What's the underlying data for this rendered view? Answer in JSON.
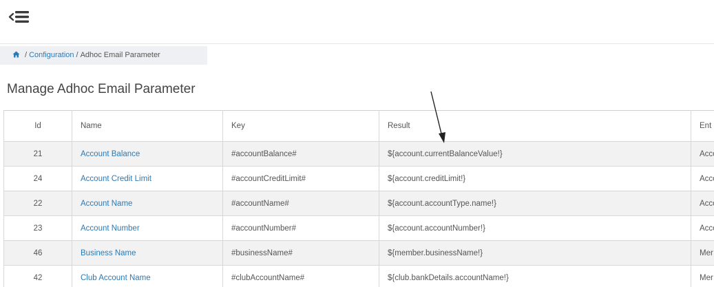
{
  "header": {
    "menu_toggle_icon": "menu-collapse-icon"
  },
  "breadcrumb": {
    "home_icon": "home-icon",
    "sep1": "/",
    "configuration": "Configuration",
    "sep2": "/",
    "current": "Adhoc Email Parameter"
  },
  "page": {
    "title": "Manage Adhoc Email Parameter"
  },
  "table": {
    "columns": {
      "id": "Id",
      "name": "Name",
      "key": "Key",
      "result": "Result",
      "entity": "Ent"
    },
    "rows": [
      {
        "id": "21",
        "name": "Account Balance",
        "key": "#accountBalance#",
        "result": "${account.currentBalanceValue!}",
        "entity": "Acco"
      },
      {
        "id": "24",
        "name": "Account Credit Limit",
        "key": "#accountCreditLimit#",
        "result": "${account.creditLimit!}",
        "entity": "Acco"
      },
      {
        "id": "22",
        "name": "Account Name",
        "key": "#accountName#",
        "result": "${account.accountType.name!}",
        "entity": "Acco"
      },
      {
        "id": "23",
        "name": "Account Number",
        "key": "#accountNumber#",
        "result": "${account.accountNumber!}",
        "entity": "Acco"
      },
      {
        "id": "46",
        "name": "Business Name",
        "key": "#businessName#",
        "result": "${member.businessName!}",
        "entity": "Mer"
      },
      {
        "id": "42",
        "name": "Club Account Name",
        "key": "#clubAccountName#",
        "result": "${club.bankDetails.accountName!}",
        "entity": "Mer"
      }
    ]
  },
  "colors": {
    "link": "#2a7ab8",
    "row_stripe": "#f2f2f2",
    "breadcrumb_bg": "#eef0f3",
    "annotation_arrow": "#222222"
  }
}
